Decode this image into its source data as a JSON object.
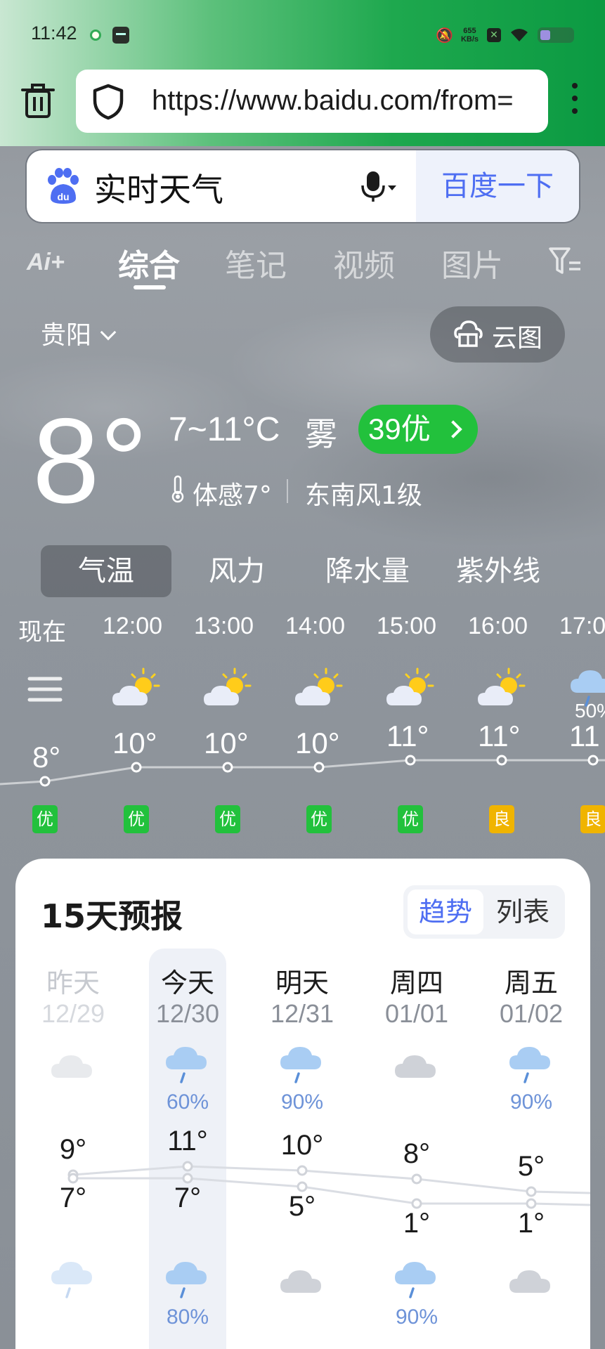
{
  "status_bar": {
    "time": "11:42",
    "net_speed_value": "655",
    "net_speed_unit": "KB/s"
  },
  "browser": {
    "url": "https://www.baidu.com/from=",
    "icons": [
      "trash-icon",
      "shield-icon",
      "more-vertical-icon"
    ]
  },
  "search": {
    "query": "实时天气",
    "button_label": "百度一下"
  },
  "tabs": {
    "ai_label": "Ai+",
    "items": [
      "综合",
      "笔记",
      "视频",
      "图片"
    ],
    "active": "综合"
  },
  "weather": {
    "city": "贵阳",
    "cloud_map_label": "云图",
    "current_temp": "8°",
    "range": "7~11°C",
    "condition": "雾",
    "aqi": "39优",
    "feels_like": "体感7°",
    "wind": "东南风1级"
  },
  "metric_tabs": [
    "气温",
    "风力",
    "降水量",
    "紫外线"
  ],
  "hourly": [
    {
      "time": "现在",
      "icon": "fog-icon",
      "temp": "8°",
      "air": "优",
      "air_color": "#22c13c"
    },
    {
      "time": "12:00",
      "icon": "partly-cloudy-icon",
      "temp": "10°",
      "air": "优",
      "air_color": "#22c13c"
    },
    {
      "time": "13:00",
      "icon": "partly-cloudy-icon",
      "temp": "10°",
      "air": "优",
      "air_color": "#22c13c"
    },
    {
      "time": "14:00",
      "icon": "partly-cloudy-icon",
      "temp": "10°",
      "air": "优",
      "air_color": "#22c13c"
    },
    {
      "time": "15:00",
      "icon": "partly-cloudy-icon",
      "temp": "11°",
      "air": "优",
      "air_color": "#22c13c"
    },
    {
      "time": "16:00",
      "icon": "partly-cloudy-icon",
      "temp": "11°",
      "air": "良",
      "air_color": "#f0b400"
    },
    {
      "time": "17:0",
      "icon": "rain-icon",
      "precip": "50%",
      "temp": "11",
      "air": "良",
      "air_color": "#f0b400"
    }
  ],
  "forecast": {
    "title": "15天预报",
    "view_trend": "趋势",
    "view_list": "列表",
    "days": [
      {
        "name": "昨天",
        "date": "12/29",
        "icon": "cloudy-icon",
        "hi": "9°",
        "lo": "7°",
        "night_icon": "rain-icon",
        "past": true
      },
      {
        "name": "今天",
        "date": "12/30",
        "icon": "rain-icon",
        "precip": "60%",
        "hi": "11°",
        "lo": "7°",
        "night_icon": "rain-icon",
        "night_precip": "80%"
      },
      {
        "name": "明天",
        "date": "12/31",
        "icon": "rain-icon",
        "precip": "90%",
        "hi": "10°",
        "lo": "5°",
        "night_icon": "cloudy-icon"
      },
      {
        "name": "周四",
        "date": "01/01",
        "icon": "cloudy-icon",
        "hi": "8°",
        "lo": "1°",
        "night_icon": "rain-icon",
        "night_precip": "90%"
      },
      {
        "name": "周五",
        "date": "01/02",
        "icon": "rain-icon",
        "precip": "90%",
        "hi": "5°",
        "lo": "1°",
        "night_icon": "cloudy-icon"
      }
    ]
  }
}
